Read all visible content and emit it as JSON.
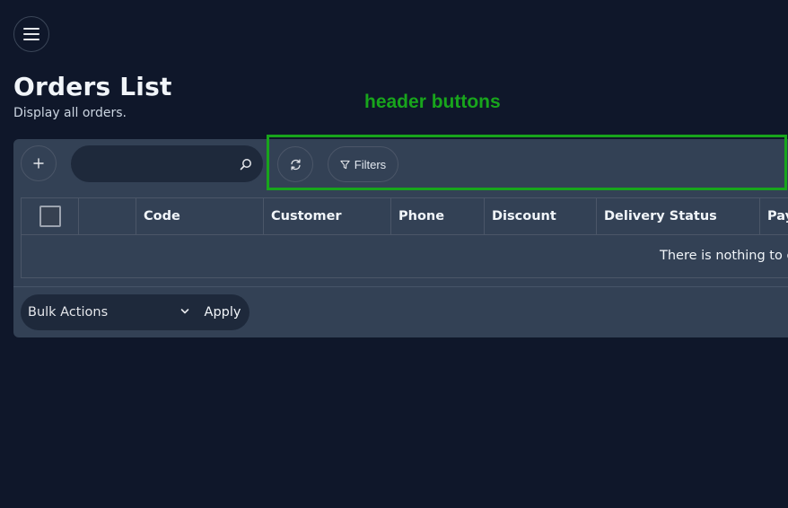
{
  "page": {
    "title": "Orders List",
    "subtitle": "Display all orders."
  },
  "annotation": {
    "label": "header buttons",
    "color": "#18a51c"
  },
  "toolbar": {
    "search_value": "",
    "filters_label": "Filters"
  },
  "table": {
    "columns": [
      "",
      "",
      "Code",
      "Customer",
      "Phone",
      "Discount",
      "Delivery Status",
      "Pay"
    ],
    "empty_message": "There is nothing to di"
  },
  "footer": {
    "bulk_actions_label": "Bulk Actions",
    "apply_label": "Apply"
  },
  "icons": {
    "menu": "hamburger-icon",
    "add": "plus-icon",
    "search": "search-icon",
    "refresh": "refresh-icon",
    "filter": "filter-icon",
    "dropdown": "chevron-down-icon"
  },
  "colors": {
    "background": "#0f172a",
    "card": "#334155",
    "input": "#1e293b",
    "highlight": "#18a51c"
  }
}
